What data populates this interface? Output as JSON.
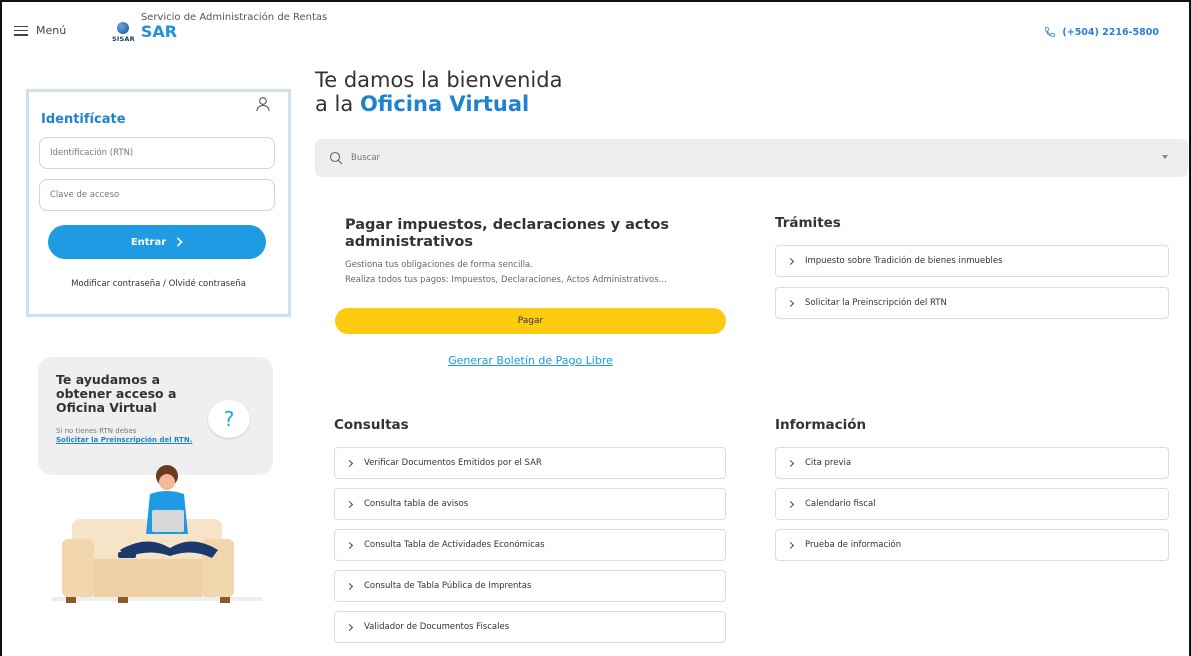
{
  "header": {
    "menu_label": "Menú",
    "logo_text": "SISAR",
    "org_subtitle": "Servicio de Administración de Rentas",
    "org_name": "SAR",
    "phone": "(+504) 2216-5800"
  },
  "login": {
    "title": "Identifícate",
    "rtn_placeholder": "Identificación (RTN)",
    "password_placeholder": "Clave de acceso",
    "submit_label": "Entrar",
    "forgot_label": "Modificar contraseña / Olvidé contraseña"
  },
  "help": {
    "title": "Te ayudamos a obtener acceso a Oficina Virtual",
    "note": "Si no tienes RTN debes",
    "link": "Solicitar la Preinscripción del RTN.",
    "bubble": "?"
  },
  "welcome": {
    "line1": "Te damos la bienvenida",
    "line2_prefix": "a la",
    "line2_highlight": "Oficina Virtual"
  },
  "search": {
    "placeholder": "Buscar"
  },
  "pay": {
    "title": "Pagar impuestos, declaraciones y actos administrativos",
    "desc1": "Gestiona tus obligaciones de forma sencilla.",
    "desc2": "Realiza todos tus pagos: Impuestos, Declaraciones, Actos Administrativos...",
    "button": "Pagar",
    "link": "Generar Boletín de Pago Libre"
  },
  "tramites": {
    "title": "Trámites",
    "items": [
      "Impuesto sobre Tradición de bienes inmuebles",
      "Solicitar la Preinscripción del RTN"
    ]
  },
  "consultas": {
    "title": "Consultas",
    "items": [
      "Verificar Documentos Emitidos por el SAR",
      "Consulta tabla de avisos",
      "Consulta Tabla de Actividades Económicas",
      "Consulta de Tabla Pública de Imprentas",
      "Validador de Documentos Fiscales"
    ]
  },
  "informacion": {
    "title": "Información",
    "items": [
      "Cita previa",
      "Calendario fiscal",
      "Prueba de información"
    ]
  },
  "colors": {
    "brand_blue": "#1e83cf",
    "button_blue": "#1e9be3",
    "pay_yellow": "#fccb0f"
  }
}
